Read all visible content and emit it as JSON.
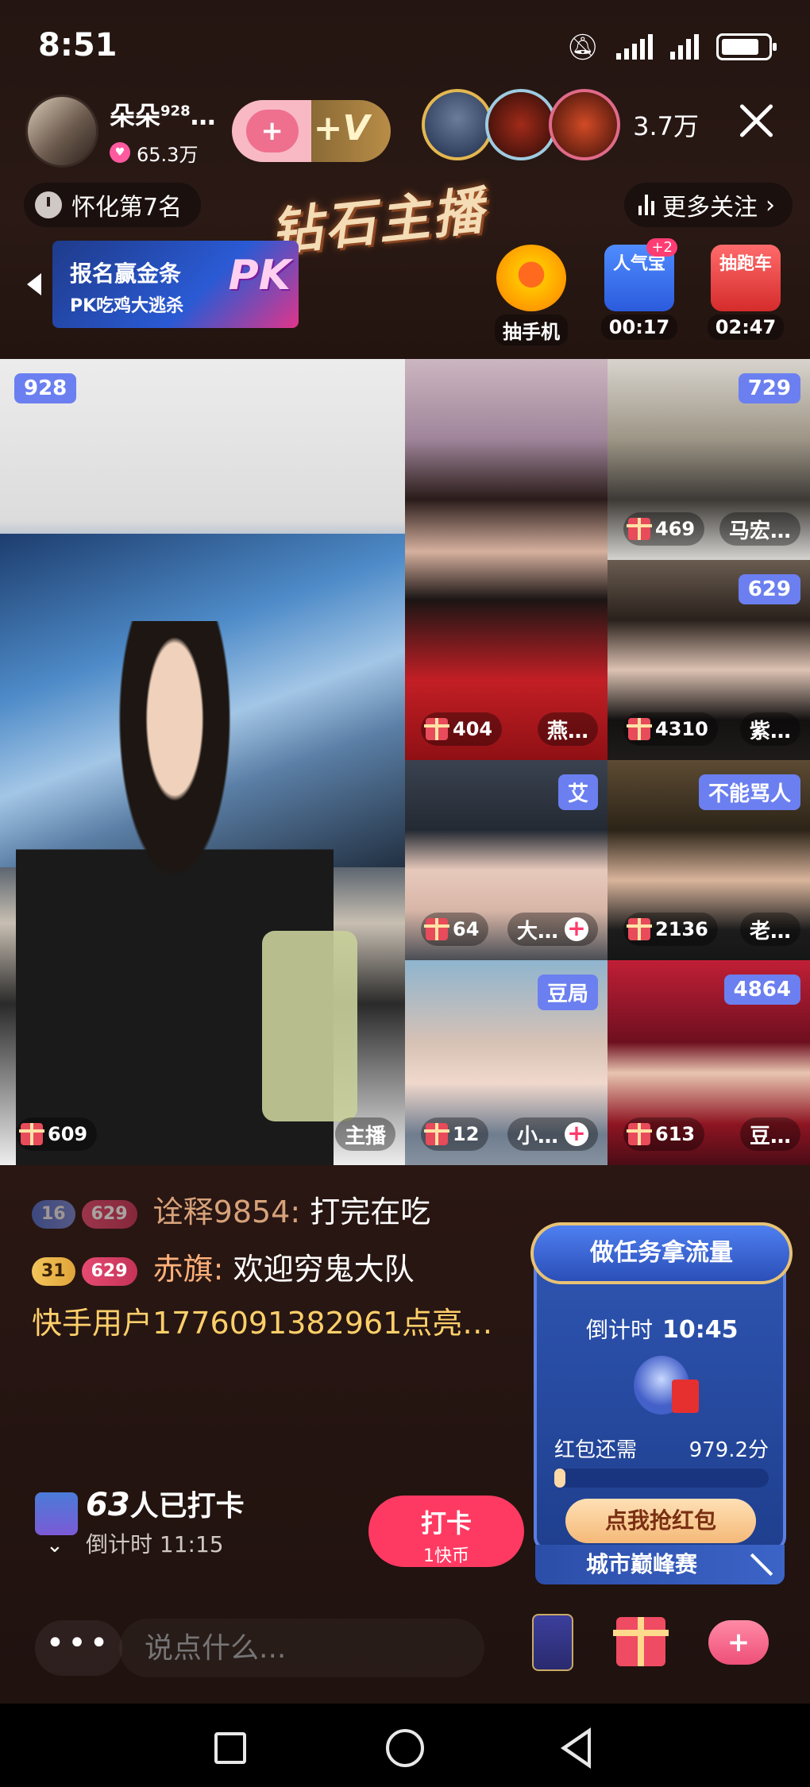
{
  "status": {
    "time": "8:51"
  },
  "host": {
    "name": "朵朵",
    "level": "928",
    "ellipsis": "…",
    "likes": "65.3万"
  },
  "viewers": {
    "count": "3.7万"
  },
  "rank": {
    "text": "怀化第7名"
  },
  "banner": {
    "title": "钻石主播",
    "more_follow": "更多关注",
    "pk_line1": "报名赢金条",
    "pk_line2": "PK吃鸡大逃杀",
    "pk_badge": "PK"
  },
  "activities": [
    {
      "label": "抽手机"
    },
    {
      "label": "00:17",
      "badge": "+2",
      "top": "人气宝"
    },
    {
      "label": "02:47",
      "top": "抽跑车"
    }
  ],
  "tiles": {
    "main": {
      "badge": "928",
      "gift": "609",
      "role": "主播"
    },
    "a": {
      "gift": "404",
      "name": "燕…"
    },
    "b": {
      "badge": "729",
      "gift": "469",
      "name": "马宏…"
    },
    "c": {
      "badge": "629",
      "gift": "4310",
      "name": "紫…"
    },
    "d": {
      "badge": "艾",
      "gift": "64",
      "name": "大…"
    },
    "e": {
      "badge": "不能骂人",
      "gift": "2136",
      "name": "老…"
    },
    "f": {
      "badge": "豆局",
      "gift": "12",
      "name": "小…"
    },
    "g": {
      "badge": "4864",
      "gift": "613",
      "name": "豆…"
    }
  },
  "chat": [
    {
      "lvl1": "16",
      "lvl2": "629",
      "name": "诠释9854:",
      "text": "打完在吃"
    },
    {
      "lvl1": "31",
      "lvl2": "629",
      "name": "赤旗:",
      "text": "欢迎穷鬼大队"
    }
  ],
  "system_msg": "快手用户1776091382961点亮…",
  "checkin": {
    "count": "63",
    "count_suffix": "人已打卡",
    "timer": "倒计时 11:15",
    "btn_main": "打卡",
    "btn_sub": "1快币"
  },
  "task": {
    "title": "做任务拿流量",
    "timer_label": "倒计时",
    "timer_value": "10:45",
    "need_label": "红包还需",
    "need_value": "979.2分",
    "progress": 0.05,
    "button": "点我抢红包"
  },
  "city": {
    "label": "城市巅峰赛"
  },
  "input": {
    "placeholder": "说点什么..."
  },
  "colors": {
    "accent_pink": "#ff3a62",
    "badge_blue": "#6b7ff0",
    "system_gold": "#ffcf6a"
  }
}
